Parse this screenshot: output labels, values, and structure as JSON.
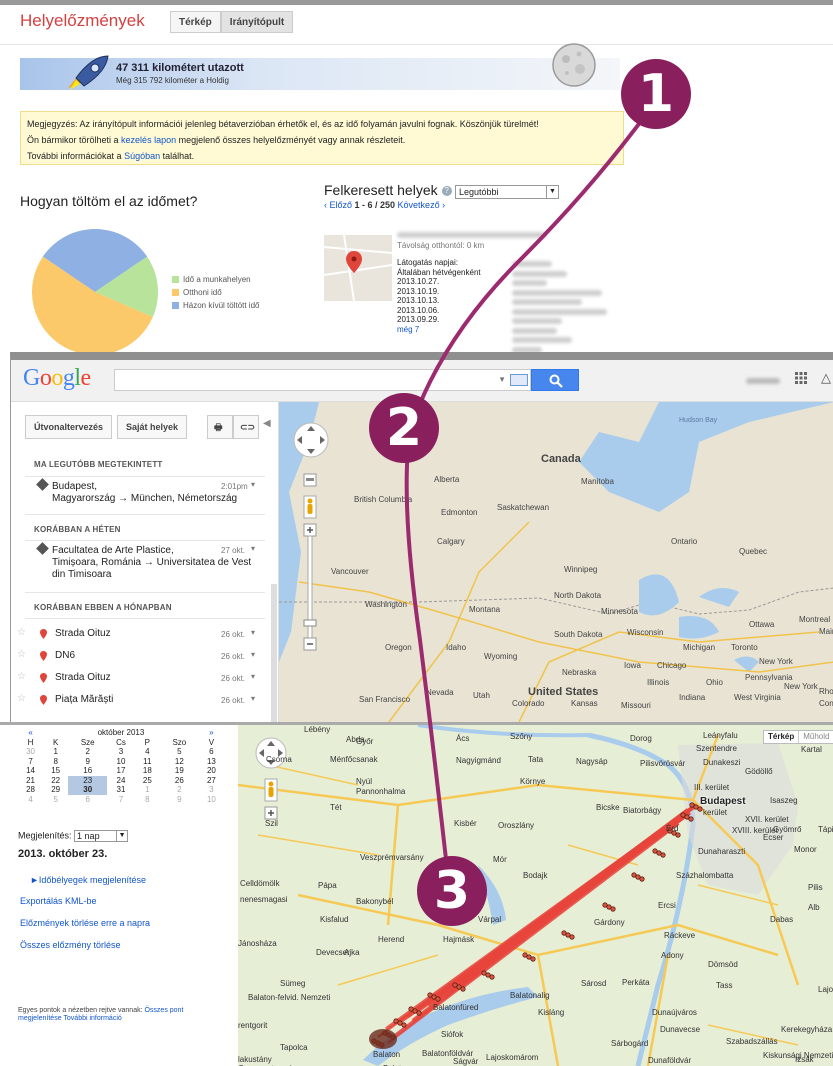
{
  "history": {
    "title": "Helyelőzmények",
    "tabs": [
      {
        "label": "Térkép"
      },
      {
        "label": "Irányítópult"
      }
    ],
    "distance": {
      "km": "47 311 kilométert utazott",
      "moon": "Még 315 792 kilométer a Holdig"
    },
    "notice": {
      "line1": "Megjegyzés: Az irányítópult információi jelenleg bétaverzióban érhetők el, és az idő folyamán javulni fognak. Köszönjük türelmét!",
      "line2a": "Ön bármikor törölheti a ",
      "line2link": "kezelés lapon",
      "line2b": " megjelenő összes helyelőzményét vagy annak részleteit.",
      "line3a": "További információkat a ",
      "line3link": "Súgóban",
      "line3b": " találhat."
    },
    "time_title": "Hogyan töltöm el az időmet?",
    "legend": [
      {
        "label": "Idő a munkahelyen",
        "color": "#b8e39b",
        "value": 16
      },
      {
        "label": "Otthoni idő",
        "color": "#fbc96a",
        "value": 53
      },
      {
        "label": "Házon kívül töltött idő",
        "color": "#8fb0e3",
        "value": 31
      }
    ],
    "places": {
      "title": "Felkeresett helyek",
      "sort": "Legutóbbi",
      "prev": "‹ Előző ",
      "range": "1 - 6 / 250",
      "next": " Következő ›",
      "distance": "Távolság otthontól: 0 km",
      "visit_days": "Látogatás napjai:",
      "usually": "Általában hétvégenként",
      "dates": [
        "2013.10.27.",
        "2013.10.19.",
        "2013.10.13.",
        "2013.10.06.",
        "2013.09.29."
      ],
      "more": "még 7"
    }
  },
  "gmaps": {
    "logo": [
      {
        "ch": "G",
        "color": "#4285f4"
      },
      {
        "ch": "o",
        "color": "#ea4335"
      },
      {
        "ch": "o",
        "color": "#fbbc05"
      },
      {
        "ch": "g",
        "color": "#4285f4"
      },
      {
        "ch": "l",
        "color": "#34a853"
      },
      {
        "ch": "e",
        "color": "#ea4335"
      }
    ],
    "btn_route": "Útvonaltervezés",
    "btn_places": "Saját helyek",
    "sections": {
      "recent": "MA LEGUTÓBB MEGTEKINTETT",
      "week": "KORÁBBAN A HÉTEN",
      "month": "KORÁBBAN EBBEN A HÓNAPBAN"
    },
    "recent": {
      "line1": "Budapest,",
      "line2": "Magyarország → München, Németország",
      "time": "2:01pm"
    },
    "week": {
      "line1": "Facultatea de Arte Plastice,",
      "line2": "Timișoara, Románia → Universitatea de Vest",
      "line3": "din Timisoara",
      "time": "27 okt."
    },
    "month_items": [
      {
        "label": "Strada Oituz",
        "time": "26 okt."
      },
      {
        "label": "DN6",
        "time": "26 okt."
      },
      {
        "label": "Strada Oituz",
        "time": "26 okt."
      },
      {
        "label": "Piața Mărăști",
        "time": "26 okt."
      }
    ],
    "map_labels": {
      "hudson": "Hudson Bay",
      "canada": "Canada",
      "alberta": "Alberta",
      "manitoba": "Manitoba",
      "bc": "British Columbia",
      "edmonton": "Edmonton",
      "saskatchewan": "Saskatchewan",
      "calgary": "Calgary",
      "vancouver": "Vancouver",
      "winnipeg": "Winnipeg",
      "ontario": "Ontario",
      "quebec": "Quebec",
      "washington": "Washington",
      "montana": "Montana",
      "nd": "North Dakota",
      "minnesota": "Minnesota",
      "ottawa": "Ottawa",
      "montreal": "Montreal",
      "maine": "Maine",
      "oregon": "Oregon",
      "idaho": "Idaho",
      "wyoming": "Wyoming",
      "sd": "South Dakota",
      "wisconsin": "Wisconsin",
      "michigan": "Michigan",
      "toronto": "Toronto",
      "newyork": "New York",
      "chicago": "Chicago",
      "iowa": "Iowa",
      "nebraska": "Nebraska",
      "us": "United States",
      "illinois": "Illinois",
      "ohio": "Ohio",
      "pennsylvania": "Pennsylvania",
      "nyc": "New York",
      "sanfrancisco": "San Francisco",
      "nevada": "Nevada",
      "utah": "Utah",
      "colorado": "Colorado",
      "kansas": "Kansas",
      "missouri": "Missouri",
      "indiana": "Indiana",
      "westvirginia": "West Virginia",
      "rhode": "Rhod",
      "connecticut": "Connecti"
    }
  },
  "calendar": {
    "month": "október 2013",
    "days": [
      "H",
      "K",
      "Sze",
      "Cs",
      "P",
      "Szo",
      "V"
    ],
    "weeks": [
      [
        "30",
        "1",
        "2",
        "3",
        "4",
        "5",
        "6"
      ],
      [
        "7",
        "8",
        "9",
        "10",
        "11",
        "12",
        "13"
      ],
      [
        "14",
        "15",
        "16",
        "17",
        "18",
        "19",
        "20"
      ],
      [
        "21",
        "22",
        "23",
        "24",
        "25",
        "26",
        "27"
      ],
      [
        "28",
        "29",
        "30",
        "31",
        "1",
        "2",
        "3"
      ],
      [
        "4",
        "5",
        "6",
        "7",
        "8",
        "9",
        "10"
      ]
    ],
    "display_label": "Megjelenítés:",
    "display_value": "1 nap",
    "date": "2013. október 23.",
    "links": [
      "►Időbélyegek megjelenítése",
      "Exportálás KML-be",
      "Előzmények törlése erre a napra",
      "Összes előzmény törlése"
    ],
    "note_a": "Egyes pontok a nézetben rejtve vannak: ",
    "note_link1": "Összes pont megjelenítése",
    "note_link2": " További információ"
  },
  "map3": {
    "toggle": [
      "Térkép",
      "Műhold"
    ],
    "labels": {
      "lebeny": "Lébény",
      "abda": "Abda",
      "gyor": "Győr",
      "acs": "Ács",
      "szony": "Szőny",
      "dorog": "Dorog",
      "leanyfalu": "Leányfalu",
      "szentendre": "Szentendre",
      "kartal": "Kartal",
      "csorna": "Csorna",
      "menfocsanak": "Ménfőcsanak",
      "nagyigmand": "Nagyigmánd",
      "tata": "Tata",
      "nagysap": "Nagysáp",
      "pilisvorosvar": "Pilisvörösvár",
      "dunakeszi": "Dunakeszi",
      "godollo": "Gödöllő",
      "nyul": "Nyúl",
      "pannonhalma": "Pannonhalma",
      "kornye": "Környe",
      "tet": "Tét",
      "bicske": "Bicske",
      "biatorbagy": "Biatorbágy",
      "budapest": "Budapest",
      "iskerulet": "III. kerület",
      "isaszeg": "Isaszeg",
      "szil": "Szil",
      "kisber": "Kisbér",
      "oroszlany": "Oroszlány",
      "keruletV": "kerület",
      "xvii": "XVII. kerület",
      "xviii": "XVIII. kerület",
      "gyomro": "Gyömrő",
      "tapi": "Tápi",
      "erd": "Érd",
      "monor": "Monor",
      "celldomolk": "Celldömölk",
      "papa": "Pápa",
      "bodajk": "Bodajk",
      "mor": "Mór",
      "dunaharaszti": "Dunaharaszti",
      "veszprem": "Veszprémvarsány",
      "szazhalombatta": "Százhalombatta",
      "bakonybel": "Bakonybél",
      "ercsi": "Ercsi",
      "nemesmagasi": "nenesmagasi",
      "kisfalud": "Kisfalud",
      "varpalota": "Várpal",
      "gardony": "Gárdony",
      "dabas": "Dabas",
      "janos": "Jánosháza",
      "devecser": "Devecser",
      "ajka": "Ajka",
      "herend": "Herend",
      "hajmasker": "Hajmásk",
      "rackeve": "Ráckeve",
      "adony": "Adony",
      "domsod": "Dömsöd",
      "sumeg": "Sümeg",
      "sarosd": "Sárosd",
      "perkata": "Perkáta",
      "tass": "Tass",
      "lajosm": "Lajosm",
      "balatonfelvidek": "Balaton-felvid. Nemzeti",
      "balatonfured": "Balatonfüred",
      "balatonalig": "Balatonalig",
      "kislang": "Kisláng",
      "dunaujvaros": "Dunaújváros",
      "kerekegyhaza": "Kerekegyháza",
      "rentgorit": "rentgorit",
      "tapolca": "Tapolca",
      "siofok": "Siófok",
      "dunavecse": "Dunavecse",
      "szabadszallas": "Szabadszállás",
      "sarbogard": "Sárbogárd",
      "lakustany": "lakustány",
      "balaton": "Balaton",
      "balatonfoldvar": "Balatonföldvár",
      "sagvar": "Ságvár",
      "lajoskomarom": "Lajoskomárom",
      "dunafoldvar": "Dunaföldvár",
      "kiskunsagi": "Kiskunsági Nemzeti Park",
      "izsak": "Izsák",
      "cserszeg": "Cserszegtomaj",
      "balatonszemes": "Balatonszemes",
      "ecer": "Ecser",
      "pilis": "Pilis",
      "alb": "Alb"
    }
  },
  "annotations": [
    {
      "label": "1"
    },
    {
      "label": "2"
    },
    {
      "label": "3"
    }
  ]
}
